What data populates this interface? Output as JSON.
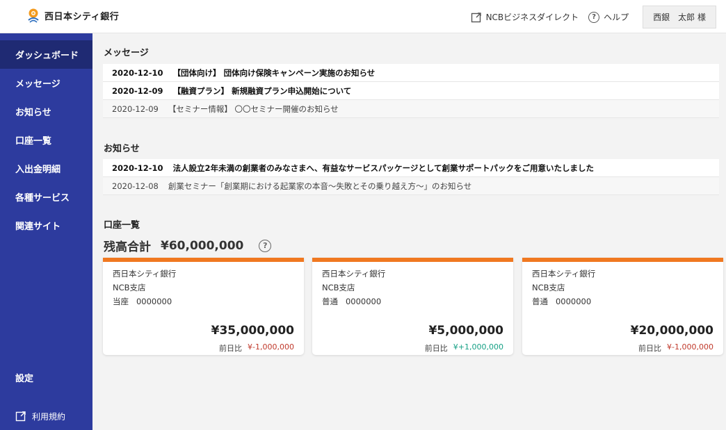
{
  "header": {
    "brand": "西日本シティ銀行",
    "ncb_link": "NCBビジネスダイレクト",
    "help_link": "ヘルプ",
    "user": "西銀　太郎 様"
  },
  "sidebar": {
    "items": [
      {
        "label": "ダッシュボード"
      },
      {
        "label": "メッセージ"
      },
      {
        "label": "お知らせ"
      },
      {
        "label": "口座一覧"
      },
      {
        "label": "入出金明細"
      },
      {
        "label": "各種サービス"
      },
      {
        "label": "関連サイト"
      }
    ],
    "settings": "設定",
    "terms": "利用規約"
  },
  "messages": {
    "title": "メッセージ",
    "items": [
      {
        "date": "2020-12-10",
        "text": "【団体向け】 団体向け保険キャンペーン実施のお知らせ"
      },
      {
        "date": "2020-12-09",
        "text": "【融資プラン】 新規融資プラン申込開始について"
      },
      {
        "date": "2020-12-09",
        "text": "【セミナー情報】 〇〇セミナー開催のお知らせ"
      }
    ]
  },
  "notices": {
    "title": "お知らせ",
    "items": [
      {
        "date": "2020-12-10",
        "text": "法人設立2年未満の創業者のみなさまへ、有益なサービスパッケージとして創業サポートパックをご用意いたしました"
      },
      {
        "date": "2020-12-08",
        "text": "創業セミナー「創業期における起業家の本音～失敗とその乗り越え方～」のお知らせ"
      }
    ]
  },
  "accounts": {
    "title": "口座一覧",
    "total_label": "残高合計",
    "total_value": "¥60,000,000",
    "compare_label": "前日比",
    "cards": [
      {
        "bank": "西日本シティ銀行",
        "branch": "NCB支店",
        "type": "当座",
        "number": "0000000",
        "amount": "¥35,000,000",
        "diff": "¥-1,000,000"
      },
      {
        "bank": "西日本シティ銀行",
        "branch": "NCB支店",
        "type": "普通",
        "number": "0000000",
        "amount": "¥5,000,000",
        "diff": "¥+1,000,000"
      },
      {
        "bank": "西日本シティ銀行",
        "branch": "NCB支店",
        "type": "普通",
        "number": "0000000",
        "amount": "¥20,000,000",
        "diff": "¥-1,000,000"
      }
    ]
  },
  "colors": {
    "sidebar": "#2d3b9e",
    "sidebar_active": "#1f2a73",
    "accent": "#f07820",
    "negative": "#c0392b",
    "positive": "#16a085"
  }
}
